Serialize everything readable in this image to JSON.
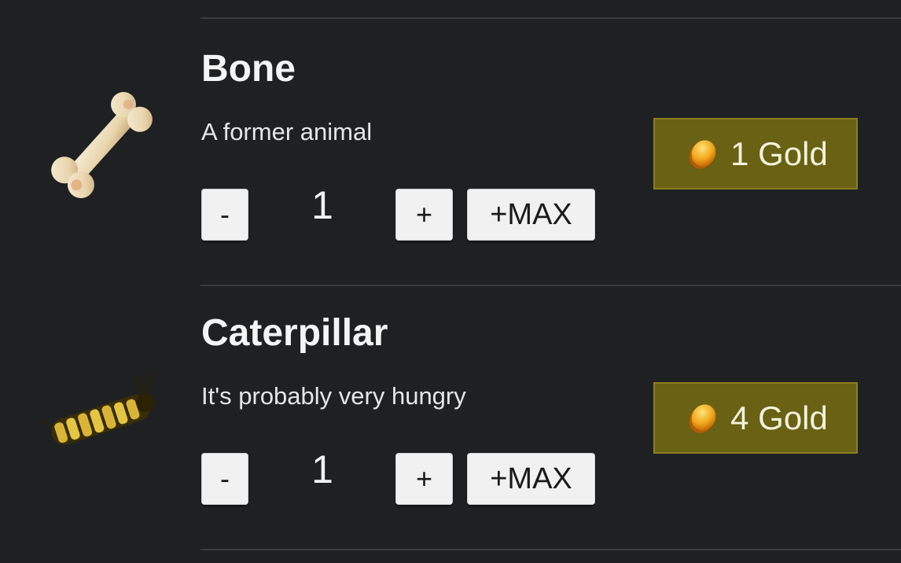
{
  "colors": {
    "background": "#1f2022",
    "price_button": "#696114",
    "divider": "#3a3b3e"
  },
  "items": [
    {
      "name": "Bone",
      "description": "A former animal",
      "icon": "bone-icon",
      "quantity": "1",
      "minus_label": "-",
      "plus_label": "+",
      "max_label": "+MAX",
      "price": "1 Gold",
      "price_icon": "gold-coin-icon"
    },
    {
      "name": "Caterpillar",
      "description": "It's probably very hungry",
      "icon": "caterpillar-icon",
      "quantity": "1",
      "minus_label": "-",
      "plus_label": "+",
      "max_label": "+MAX",
      "price": "4 Gold",
      "price_icon": "gold-coin-icon"
    }
  ]
}
